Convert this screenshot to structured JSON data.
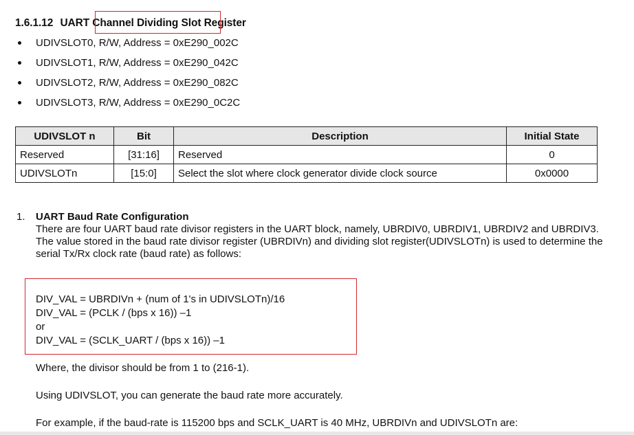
{
  "heading": {
    "number": "1.6.1.12",
    "text": "UART Channel Dividing Slot Register"
  },
  "addresses": [
    "UDIVSLOT0, R/W, Address = 0xE290_002C",
    "UDIVSLOT1, R/W, Address = 0xE290_042C",
    "UDIVSLOT2, R/W, Address = 0xE290_082C",
    "UDIVSLOT3, R/W, Address = 0xE290_0C2C"
  ],
  "table": {
    "headers": [
      "UDIVSLOT n",
      "Bit",
      "Description",
      "Initial State"
    ],
    "rows": [
      [
        "Reserved",
        "[31:16]",
        "Reserved",
        "0"
      ],
      [
        "UDIVSLOTn",
        "[15:0]",
        "Select the slot where clock generator divide clock source",
        "0x0000"
      ]
    ]
  },
  "section": {
    "number": "1.",
    "title": "UART Baud Rate Configuration",
    "paragraph1": "There are four UART baud rate divisor registers in the UART block, namely, UBRDIV0, UBRDIV1, UBRDIV2 and UBRDIV3.",
    "paragraph2": "The value stored in the baud rate divisor register (UBRDIVn) and dividing slot register(UDIVSLOTn) is used to determine the serial Tx/Rx clock rate (baud rate) as follows:"
  },
  "formulas": [
    "DIV_VAL = UBRDIVn + (num of 1's in UDIVSLOTn)/16",
    "DIV_VAL = (PCLK / (bps x 16)) –1",
    "or",
    "DIV_VAL = (SCLK_UART / (bps x 16)) –1"
  ],
  "paragraphs": [
    "Where, the divisor should be from 1 to (216-1).",
    "Using UDIVSLOT, you can generate the baud rate more accurately.",
    "For example, if the baud-rate is 115200 bps and SCLK_UART is 40 MHz, UBRDIVn and UDIVSLOTn are:"
  ],
  "colors": {
    "highlight_box": "#d0252c",
    "table_header_bg": "#e6e6e6"
  }
}
